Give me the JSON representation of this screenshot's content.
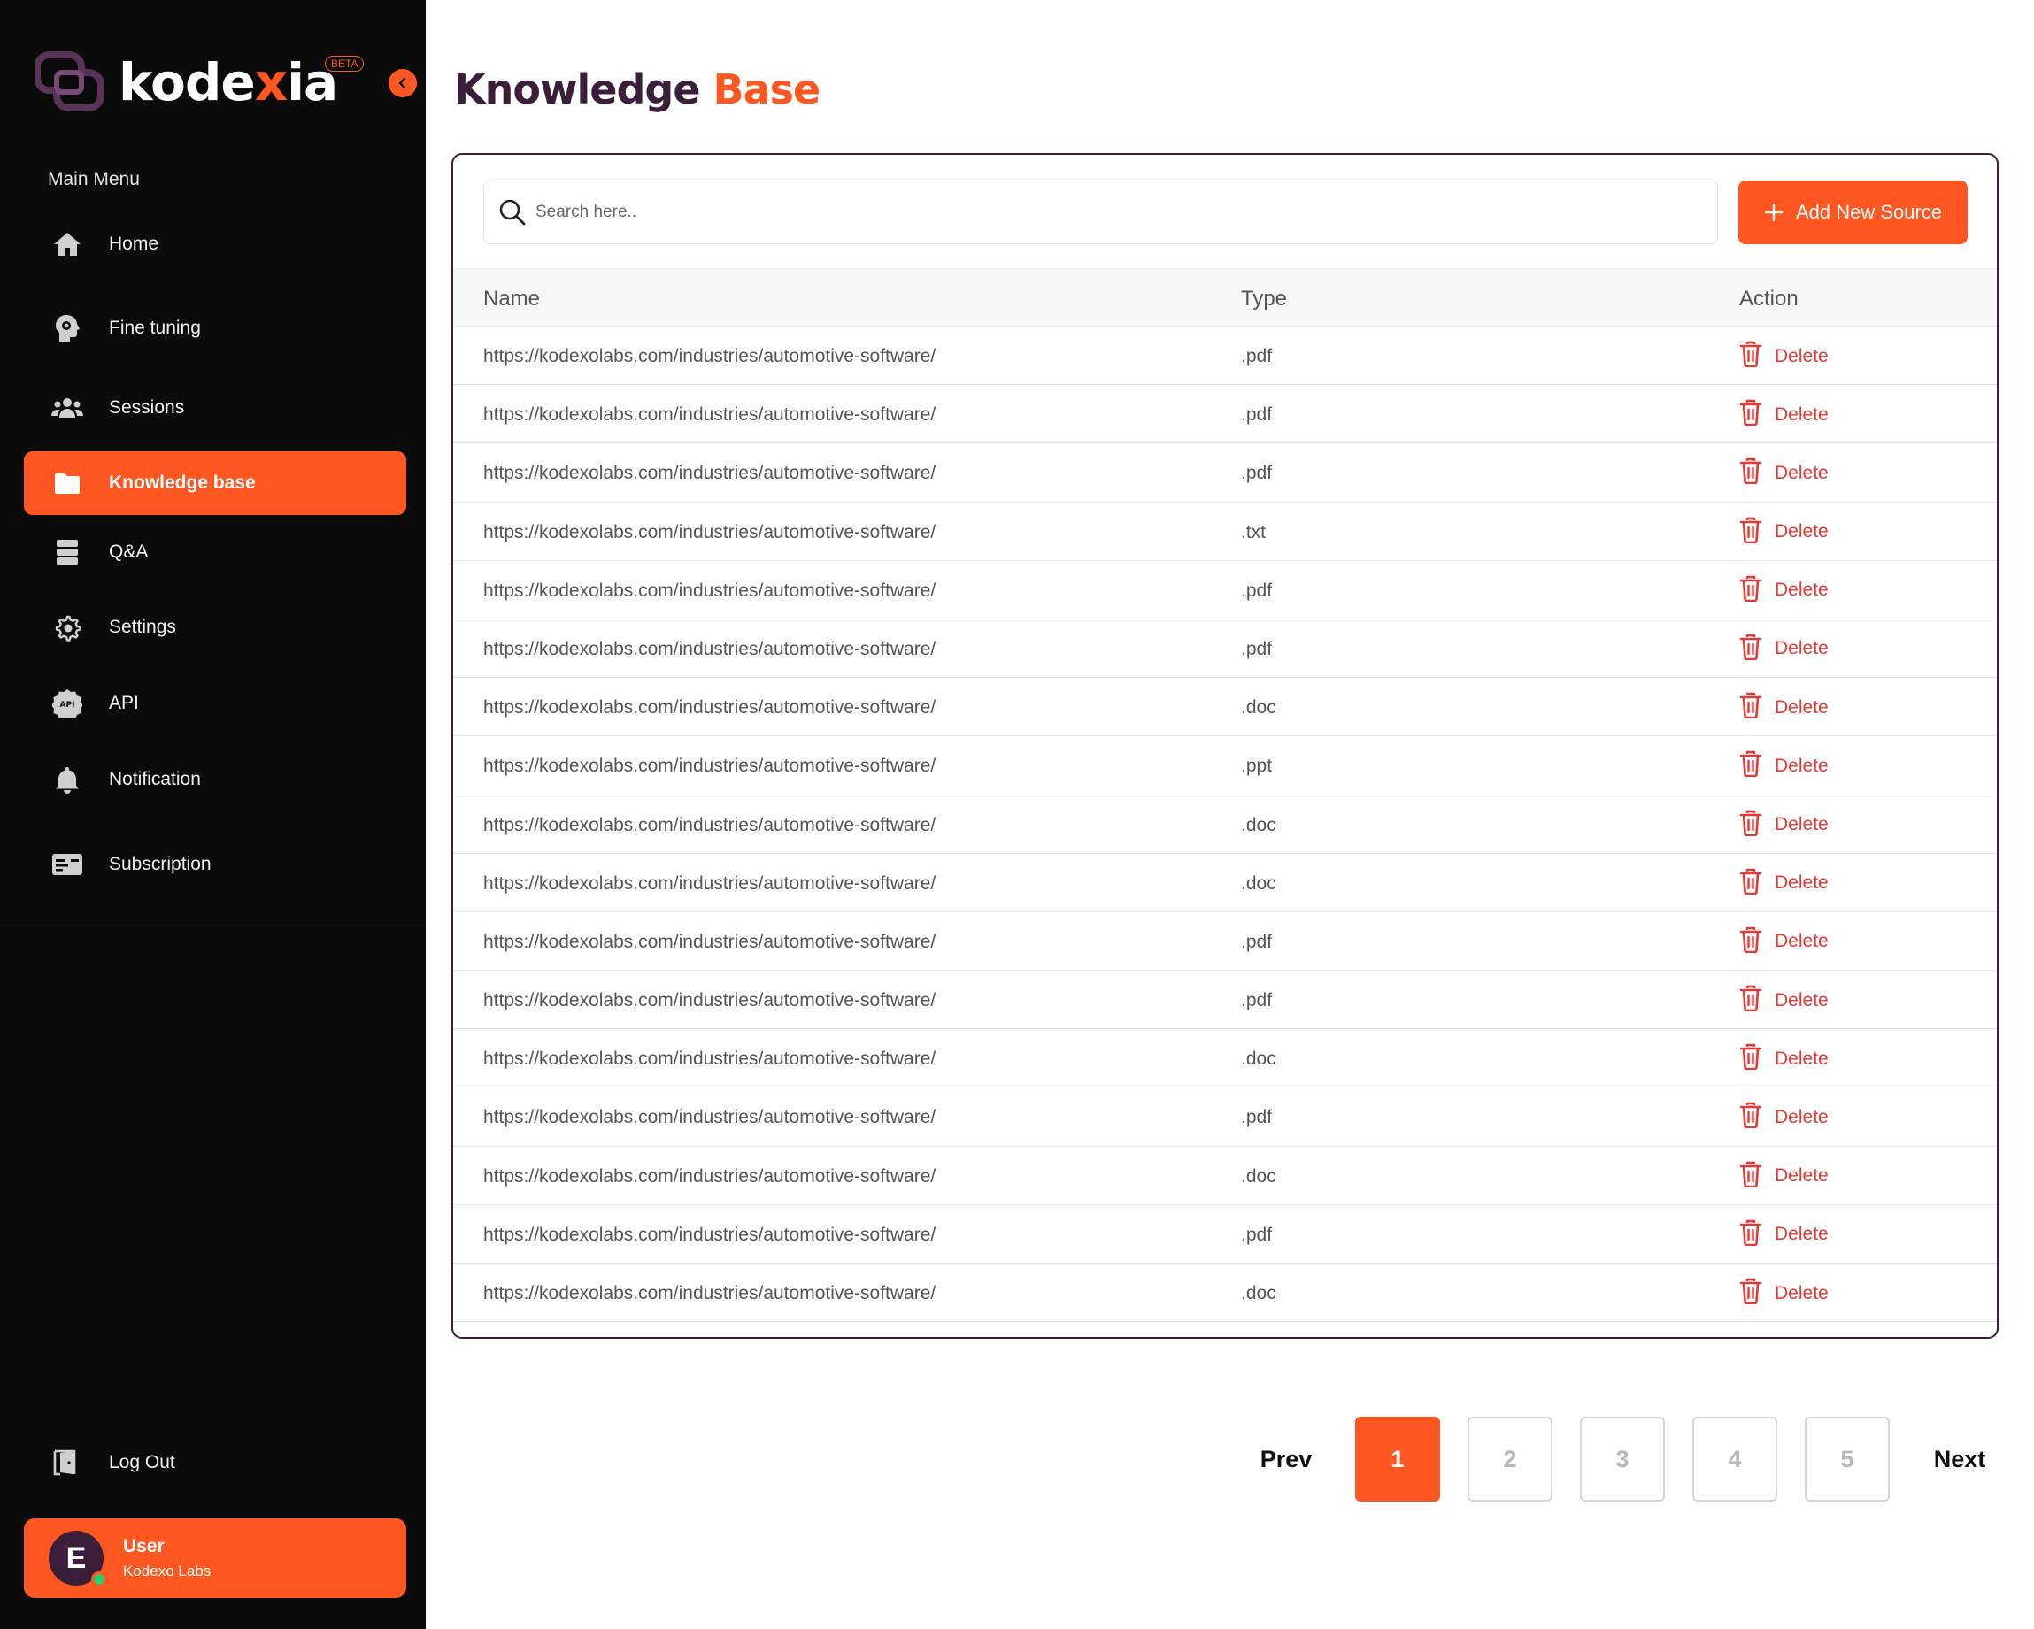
{
  "app": {
    "logo_text_a": "kode",
    "logo_text_x": "x",
    "logo_text_b": "ia",
    "beta_badge": "BETA",
    "accent_color": "#ff5722",
    "brand_dark": "#3b1f3a"
  },
  "sidebar": {
    "section_label": "Main Menu",
    "items": [
      {
        "label": "Home",
        "icon": "home-icon",
        "active": false
      },
      {
        "label": "Fine tuning",
        "icon": "head-gear-icon",
        "active": false
      },
      {
        "label": "Sessions",
        "icon": "users-icon",
        "active": false
      },
      {
        "label": "Knowledge base",
        "icon": "folder-icon",
        "active": true
      },
      {
        "label": "Q&A",
        "icon": "database-icon",
        "active": false
      },
      {
        "label": "Settings",
        "icon": "gear-icon",
        "active": false
      },
      {
        "label": "API",
        "icon": "api-badge-icon",
        "active": false
      },
      {
        "label": "Notification",
        "icon": "bell-icon",
        "active": false
      },
      {
        "label": "Subscription",
        "icon": "card-icon",
        "active": false
      }
    ],
    "logout_label": "Log Out",
    "user": {
      "initial": "E",
      "name": "User",
      "org": "Kodexo Labs",
      "status": "online"
    }
  },
  "page": {
    "title_part1": "Knowledge",
    "title_part2": "Base"
  },
  "toolbar": {
    "search_placeholder": "Search here..",
    "add_button_label": "Add New Source"
  },
  "table": {
    "columns": [
      "Name",
      "Type",
      "Action"
    ],
    "action_label": "Delete",
    "rows": [
      {
        "name": "https://kodexolabs.com/industries/automotive-software/",
        "type": ".pdf"
      },
      {
        "name": "https://kodexolabs.com/industries/automotive-software/",
        "type": ".pdf"
      },
      {
        "name": "https://kodexolabs.com/industries/automotive-software/",
        "type": ".pdf"
      },
      {
        "name": "https://kodexolabs.com/industries/automotive-software/",
        "type": ".txt"
      },
      {
        "name": "https://kodexolabs.com/industries/automotive-software/",
        "type": ".pdf"
      },
      {
        "name": "https://kodexolabs.com/industries/automotive-software/",
        "type": ".pdf"
      },
      {
        "name": "https://kodexolabs.com/industries/automotive-software/",
        "type": ".doc"
      },
      {
        "name": "https://kodexolabs.com/industries/automotive-software/",
        "type": ".ppt"
      },
      {
        "name": "https://kodexolabs.com/industries/automotive-software/",
        "type": ".doc"
      },
      {
        "name": "https://kodexolabs.com/industries/automotive-software/",
        "type": ".doc"
      },
      {
        "name": "https://kodexolabs.com/industries/automotive-software/",
        "type": ".pdf"
      },
      {
        "name": "https://kodexolabs.com/industries/automotive-software/",
        "type": ".pdf"
      },
      {
        "name": "https://kodexolabs.com/industries/automotive-software/",
        "type": ".doc"
      },
      {
        "name": "https://kodexolabs.com/industries/automotive-software/",
        "type": ".pdf"
      },
      {
        "name": "https://kodexolabs.com/industries/automotive-software/",
        "type": ".doc"
      },
      {
        "name": "https://kodexolabs.com/industries/automotive-software/",
        "type": ".pdf"
      },
      {
        "name": "https://kodexolabs.com/industries/automotive-software/",
        "type": ".doc"
      }
    ]
  },
  "pagination": {
    "prev_label": "Prev",
    "next_label": "Next",
    "pages": [
      "1",
      "2",
      "3",
      "4",
      "5"
    ],
    "current": "1"
  }
}
